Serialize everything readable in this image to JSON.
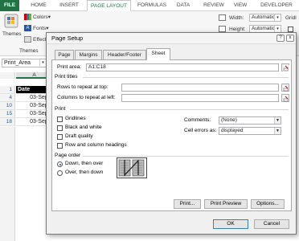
{
  "ribbon": {
    "tabs": [
      "FILE",
      "HOME",
      "INSERT",
      "PAGE LAYOUT",
      "FORMULAS",
      "DATA",
      "REVIEW",
      "VIEW",
      "DEVELOPER"
    ],
    "active_tab": "PAGE LAYOUT",
    "themes_label": "Themes",
    "colors_label": "Colors",
    "fonts_label": "Fonts",
    "effects_label": "Effects",
    "group_label": "Themes",
    "width_label": "Width:",
    "width_value": "Automatic",
    "height_label": "Height:",
    "height_value": "Automatic",
    "gridlines_label": "Gridl"
  },
  "name_box": {
    "value": "Print_Area"
  },
  "sheet": {
    "column_header": "A",
    "rows": [
      {
        "num": "1",
        "value": "Date"
      },
      {
        "num": "4",
        "value": "03-Sep-"
      },
      {
        "num": "10",
        "value": "03-Sep-"
      },
      {
        "num": "15",
        "value": "03-Sep-"
      },
      {
        "num": "18",
        "value": "03-Sep-"
      }
    ]
  },
  "dialog": {
    "title": "Page Setup",
    "help_icon": "?",
    "close_icon": "x",
    "tabs": [
      "Page",
      "Margins",
      "Header/Footer",
      "Sheet"
    ],
    "active_tab": "Sheet",
    "print_area_label": "Print area:",
    "print_area_value": "A1:C18",
    "print_titles_label": "Print titles",
    "rows_repeat_label": "Rows to repeat at top:",
    "rows_repeat_value": "",
    "cols_repeat_label": "Columns to repeat at left:",
    "cols_repeat_value": "",
    "print_label": "Print",
    "gridlines_label": "Gridlines",
    "black_white_label": "Black and white",
    "draft_quality_label": "Draft quality",
    "row_col_headings_label": "Row and column headings",
    "comments_label": "Comments:",
    "comments_value": "(None)",
    "cell_errors_label": "Cell errors as:",
    "cell_errors_value": "displayed",
    "page_order_label": "Page order",
    "down_then_over_label": "Down, then over",
    "over_then_down_label": "Over, then down",
    "page_order_selected": "Down, then over",
    "print_button": "Print...",
    "print_preview_button": "Print Preview",
    "options_button": "Options...",
    "ok_button": "OK",
    "cancel_button": "Cancel"
  }
}
